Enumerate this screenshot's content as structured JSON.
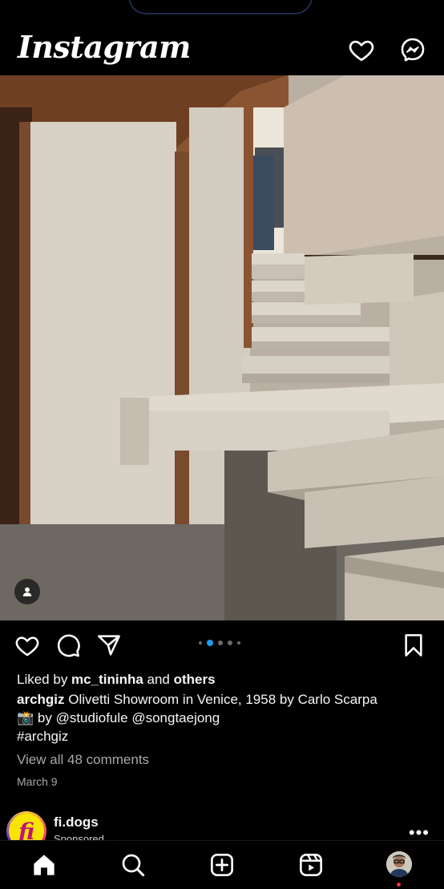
{
  "app": {
    "logo": "Instagram"
  },
  "post": {
    "liked_by_prefix": "Liked by ",
    "liked_by_user": "mc_tininha",
    "liked_by_mid": " and ",
    "liked_by_others": "others",
    "author": "archgiz",
    "caption_line1": " Olivetti Showroom in Venice, 1958 by Carlo Scarpa",
    "caption_line2": "📸 by @studiofule @songtaejong",
    "hashtag": "#archgiz",
    "view_comments": "View all 48 comments",
    "date": "March 9",
    "carousel": {
      "count": 5,
      "active_index": 1
    }
  },
  "next_post": {
    "avatar_letter": "fi",
    "username": "fi.dogs",
    "subtitle": "Sponsored",
    "more": "•••"
  },
  "colors": {
    "accent": "#1d9bf0",
    "notification": "#ff3040",
    "background": "#000000"
  }
}
